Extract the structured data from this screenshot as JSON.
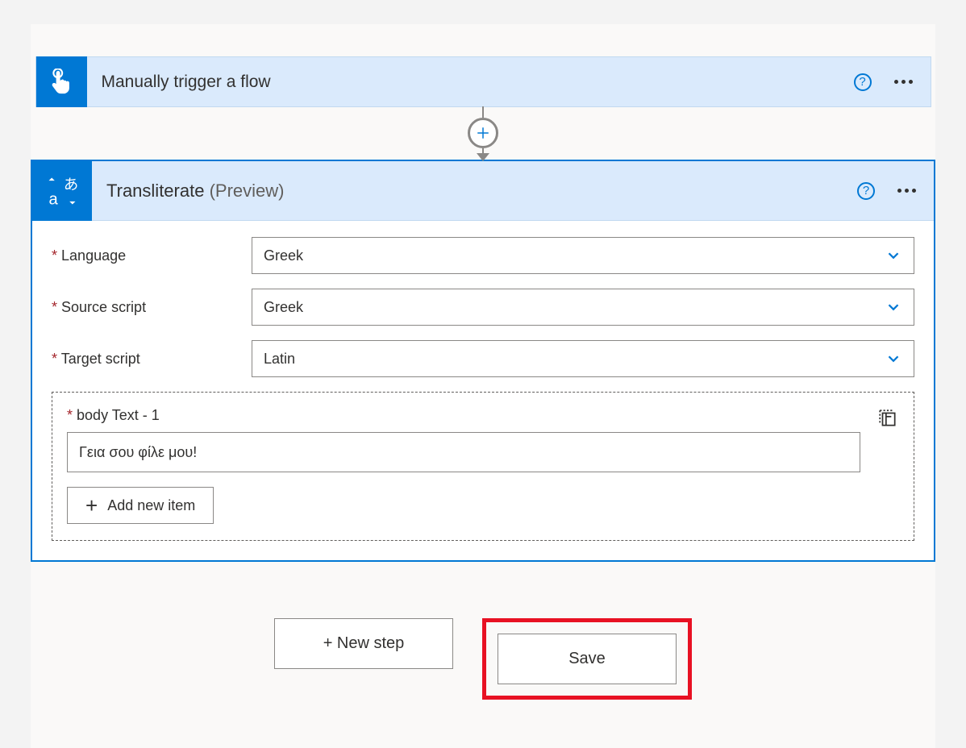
{
  "trigger": {
    "title": "Manually trigger a flow"
  },
  "action": {
    "title": "Transliterate",
    "suffix": "(Preview)",
    "help_symbol": "?",
    "fields": {
      "language": {
        "label": "Language",
        "value": "Greek"
      },
      "source_script": {
        "label": "Source script",
        "value": "Greek"
      },
      "target_script": {
        "label": "Target script",
        "value": "Latin"
      }
    },
    "array": {
      "label": "body Text - 1",
      "value": "Γεια σου φίλε μου!",
      "add_label": "Add new item"
    }
  },
  "footer": {
    "new_step": "+ New step",
    "save": "Save"
  },
  "symbols": {
    "plus": "+"
  }
}
